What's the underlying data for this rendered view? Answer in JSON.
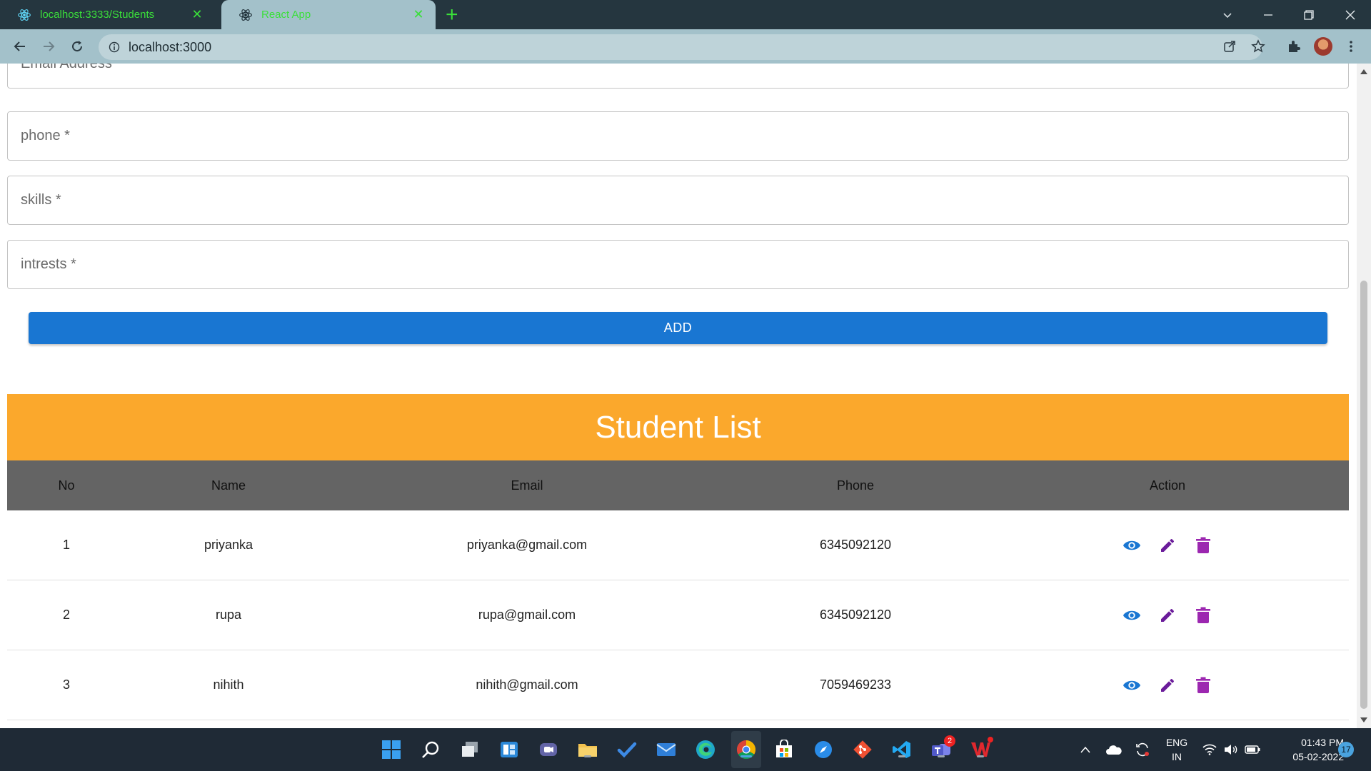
{
  "browser": {
    "tabs": [
      {
        "title": "localhost:3333/Students",
        "active": false
      },
      {
        "title": "React App",
        "active": true
      }
    ],
    "url": "localhost:3000"
  },
  "form": {
    "email_label": "Email Address *",
    "phone_label": "phone *",
    "skills_label": "skills *",
    "interests_label": "intrests *",
    "add_label": "ADD"
  },
  "student_list": {
    "title": "Student List",
    "columns": [
      "No",
      "Name",
      "Email",
      "Phone",
      "Action"
    ],
    "rows": [
      {
        "no": "1",
        "name": "priyanka",
        "email": "priyanka@gmail.com",
        "phone": "6345092120"
      },
      {
        "no": "2",
        "name": "rupa",
        "email": "rupa@gmail.com",
        "phone": "6345092120"
      },
      {
        "no": "3",
        "name": "nihith",
        "email": "nihith@gmail.com",
        "phone": "7059469233"
      }
    ],
    "actions": [
      "view-icon",
      "edit-icon",
      "delete-icon"
    ]
  },
  "colors": {
    "title_bar": "#fba82c",
    "add_button": "#1976d2",
    "table_header": "#646464",
    "view_icon": "#1976d2",
    "edit_icon": "#6a1b9a",
    "delete_icon": "#9c27b0"
  },
  "taskbar": {
    "teams_badge": "2",
    "language": "ENG",
    "region": "IN",
    "time": "01:43 PM",
    "date": "05-02-2022",
    "notifications": "17"
  }
}
